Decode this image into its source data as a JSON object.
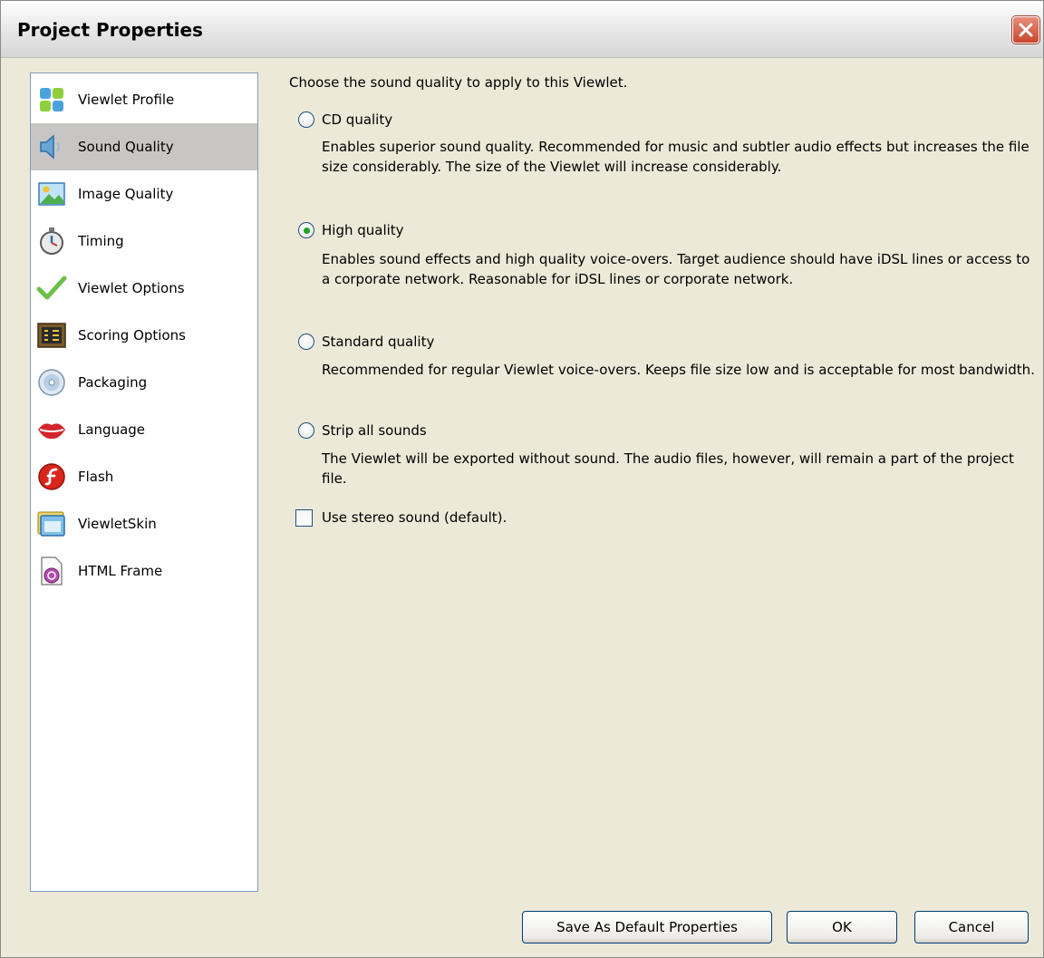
{
  "window": {
    "title": "Project Properties"
  },
  "sidebar": {
    "items": [
      {
        "label": "Viewlet Profile",
        "icon": "profile-icon",
        "selected": false
      },
      {
        "label": "Sound Quality",
        "icon": "speaker-icon",
        "selected": true
      },
      {
        "label": "Image Quality",
        "icon": "picture-icon",
        "selected": false
      },
      {
        "label": "Timing",
        "icon": "stopwatch-icon",
        "selected": false
      },
      {
        "label": "Viewlet Options",
        "icon": "checkmark-icon",
        "selected": false
      },
      {
        "label": "Scoring Options",
        "icon": "scoreboard-icon",
        "selected": false
      },
      {
        "label": "Packaging",
        "icon": "disc-icon",
        "selected": false
      },
      {
        "label": "Language",
        "icon": "lips-icon",
        "selected": false
      },
      {
        "label": "Flash",
        "icon": "flash-icon",
        "selected": false
      },
      {
        "label": "ViewletSkin",
        "icon": "window-skin-icon",
        "selected": false
      },
      {
        "label": "HTML Frame",
        "icon": "html-frame-icon",
        "selected": false
      }
    ]
  },
  "main": {
    "intro": "Choose the sound quality to apply to this Viewlet.",
    "options": [
      {
        "label": "CD quality",
        "checked": false,
        "description": "Enables superior sound quality. Recommended for music and subtler audio effects but increases the file size considerably. The size of the Viewlet will increase considerably."
      },
      {
        "label": "High quality",
        "checked": true,
        "description": "Enables sound effects and high quality voice-overs. Target audience should have iDSL lines or access to a corporate network. Reasonable for iDSL lines or corporate network."
      },
      {
        "label": "Standard quality",
        "checked": false,
        "description": "Recommended for regular Viewlet voice-overs. Keeps file size low and is acceptable for most bandwidth."
      },
      {
        "label": "Strip all sounds",
        "checked": false,
        "description": "The Viewlet will be exported without sound. The audio files, however, will remain a part of the project file."
      }
    ],
    "stereo": {
      "label": "Use stereo sound (default).",
      "checked": false
    }
  },
  "buttons": {
    "save_default": "Save As Default Properties",
    "ok": "OK",
    "cancel": "Cancel"
  },
  "colors": {
    "selection": "#c8c6c4",
    "radio_dot": "#21a121",
    "close_button": "#c8462d"
  }
}
